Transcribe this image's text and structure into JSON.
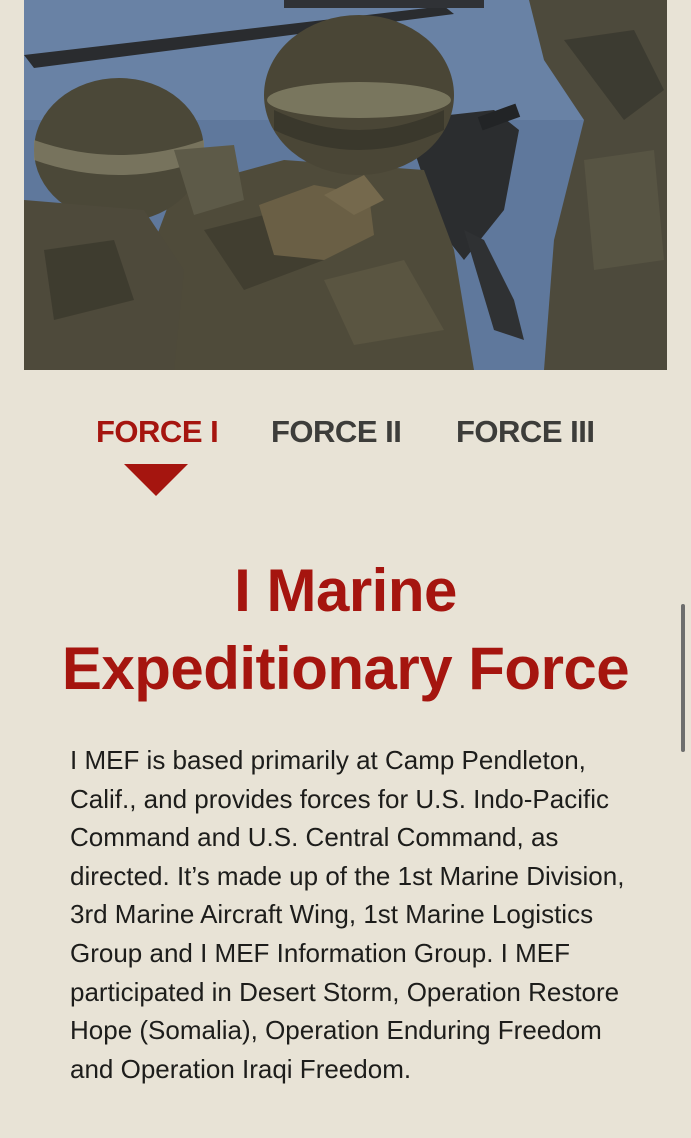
{
  "hero": {
    "image_alt": "Marines in helmets and camouflage at a mounted machine gun over the ocean"
  },
  "tabs": [
    {
      "label": "FORCE I",
      "active": true
    },
    {
      "label": "FORCE II",
      "active": false
    },
    {
      "label": "FORCE III",
      "active": false
    }
  ],
  "content": {
    "title_line1": "I Marine",
    "title_line2": "Expeditionary Force",
    "body": "I MEF is based primarily at Camp Pendleton, Calif., and provides forces for U.S. Indo-Pacific Command and U.S. Central Command, as directed. It’s made up of the 1st Marine Division, 3rd Marine Aircraft Wing, 1st Marine Logistics Group and I MEF Information Group. I MEF participated in Desert Storm, Operation Restore Hope (Somalia), Operation Enduring Freedom and Operation Iraqi Freedom."
  },
  "colors": {
    "background": "#e8e3d6",
    "accent": "#a5150f",
    "tab_inactive": "#3d3d3a",
    "text": "#1d1d1b"
  },
  "icons": {
    "active_tab_indicator": "caret-down-icon"
  }
}
